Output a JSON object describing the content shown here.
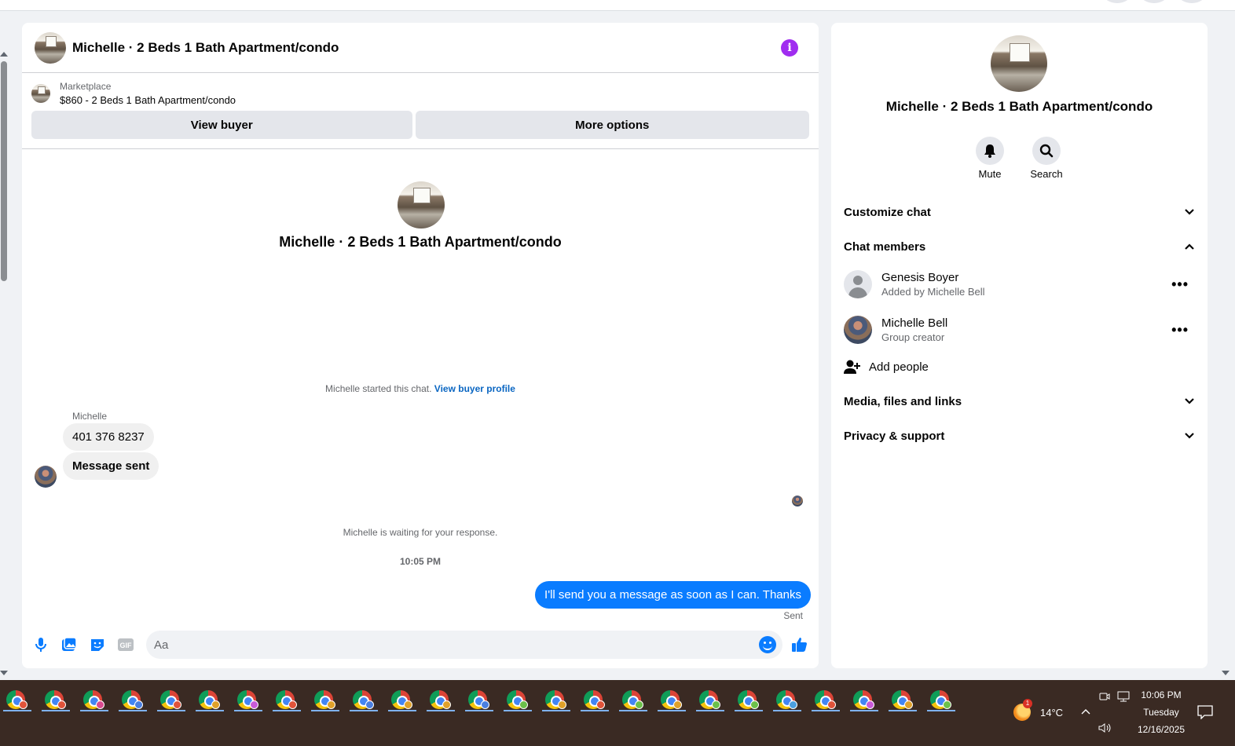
{
  "chat": {
    "header_title": "Michelle · 2 Beds 1 Bath Apartment/condo",
    "marketplace": {
      "label": "Marketplace",
      "listing": "$860 - 2 Beds 1 Bath Apartment/condo",
      "view_buyer": "View buyer",
      "more_options": "More options"
    },
    "intro_title": "Michelle · 2 Beds 1 Bath Apartment/condo",
    "started_text": "Michelle started this chat.",
    "view_buyer_profile": "View buyer profile",
    "sender_name": "Michelle",
    "messages_in": [
      "401 376 8237",
      "Message sent"
    ],
    "waiting_text": "Michelle is waiting for your response.",
    "timestamp": "10:05 PM",
    "message_out": "I'll send you a message as soon as I can. Thanks",
    "sent_status": "Sent",
    "composer_placeholder": "Aa"
  },
  "info_panel": {
    "title": "Michelle · 2 Beds 1 Bath Apartment/condo",
    "actions": [
      {
        "label": "Mute",
        "icon": "bell-icon"
      },
      {
        "label": "Search",
        "icon": "search-icon"
      }
    ],
    "sections": {
      "customize": "Customize chat",
      "members": "Chat members",
      "media": "Media, files and links",
      "privacy": "Privacy & support"
    },
    "members": [
      {
        "name": "Genesis Boyer",
        "sub": "Added by Michelle Bell"
      },
      {
        "name": "Michelle Bell",
        "sub": "Group creator"
      }
    ],
    "add_people": "Add people",
    "more_glyph": "•••"
  },
  "taskbar": {
    "weather_temp": "14°C",
    "weather_badge": "1",
    "time": "10:06 PM",
    "day": "Tuesday",
    "date": "12/16/2025",
    "app_count_label": "Chrome",
    "profile_dot_colors": [
      "#e0533a",
      "#e0533a",
      "#d84a8f",
      "#4a7fe0",
      "#e0533a",
      "#e0a12a",
      "#c95ad8",
      "#e0533a",
      "#e0a12a",
      "#4a7fe0",
      "#e0a12a",
      "#e0a12a",
      "#4a7fe0",
      "#6bc04a",
      "#e0a12a",
      "#e0533a",
      "#6bc04a",
      "#e0a12a",
      "#6bc04a",
      "#6bc04a",
      "#4a9fe0",
      "#e0533a",
      "#c95ad8",
      "#e0a12a",
      "#6bc04a"
    ]
  },
  "colors": {
    "accent_blue": "#0a7cff",
    "link_blue": "#0a66c2",
    "info_purple": "#a02cf0"
  }
}
